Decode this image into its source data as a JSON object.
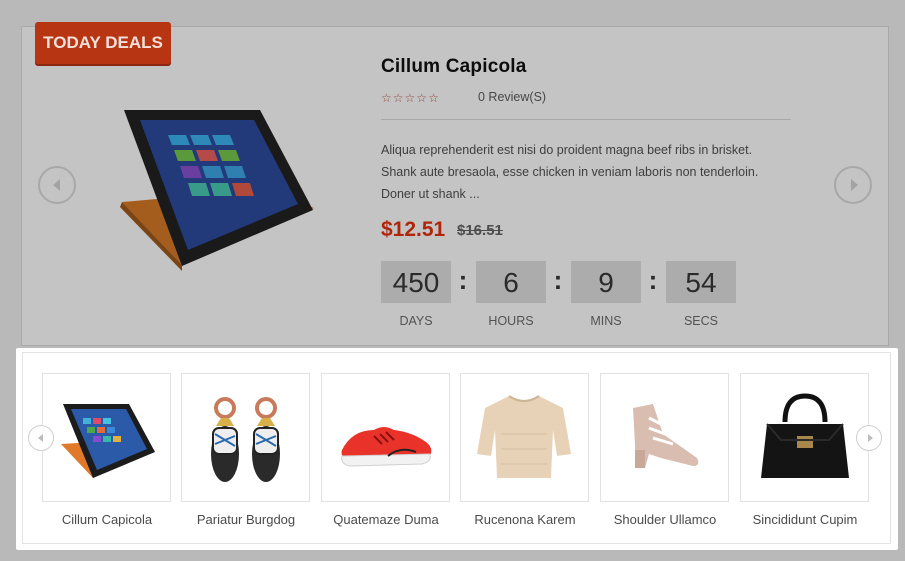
{
  "deal": {
    "badge": "TODAY DEALS",
    "title": "Cillum Capicola",
    "rating_stars": 5,
    "reviews": "0 Review(S)",
    "description": "Aliqua reprehenderit est nisi do proident magna beef ribs in brisket. Shank aute bresaola, esse chicken in veniam laboris non tenderloin. Doner ut shank ...",
    "price": "$12.51",
    "old_price": "$16.51",
    "countdown": {
      "days": "450",
      "hours": "6",
      "mins": "9",
      "secs": "54",
      "days_label": "DAYS",
      "hours_label": "HOURS",
      "mins_label": "MINS",
      "secs_label": "SECS",
      "separator": ":"
    },
    "prev_icon": "chevron-left-icon",
    "next_icon": "chevron-right-icon"
  },
  "thumbnails": [
    {
      "label": "Cillum Capicola",
      "icon": "laptop-tablet-image"
    },
    {
      "label": "Pariatur Burgdog",
      "icon": "sandals-image"
    },
    {
      "label": "Quatemaze Duma",
      "icon": "sneaker-image"
    },
    {
      "label": "Rucenona Karem",
      "icon": "sweater-image"
    },
    {
      "label": "Shoulder Ullamco",
      "icon": "heeled-shoe-image"
    },
    {
      "label": "Sincididunt Cupim",
      "icon": "handbag-image"
    }
  ],
  "colors": {
    "badge": "#c53b16",
    "price": "#d43c10",
    "overlay": "#b9b9b9",
    "carousel_bg": "#ffffff"
  }
}
